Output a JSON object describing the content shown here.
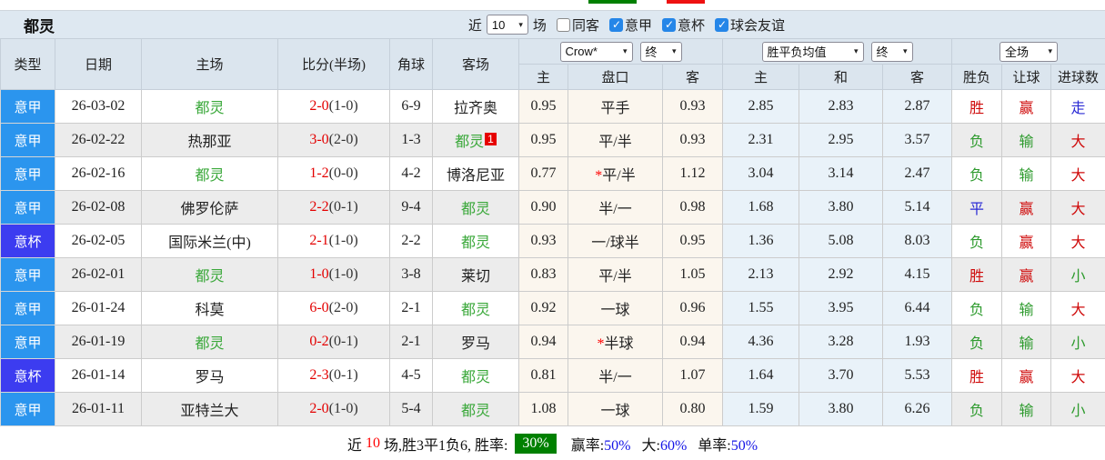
{
  "title": "都灵",
  "filters": {
    "near_label": "近",
    "recent_value": "10",
    "games_label": "场",
    "checkboxes": [
      {
        "label": "同客",
        "state": ""
      },
      {
        "label": "意甲",
        "state": "checked"
      },
      {
        "label": "意杯",
        "state": "checked"
      },
      {
        "label": "球会友谊",
        "state": "checked"
      }
    ]
  },
  "header": {
    "cols": [
      "类型",
      "日期",
      "主场",
      "比分(半场)",
      "角球",
      "客场"
    ],
    "odds_company_select": "Crow*",
    "odds_stage_select": "终",
    "odds_sub": [
      "主",
      "盘口",
      "客"
    ],
    "avg_select": "胜平负均值",
    "avg_stage_select": "终",
    "avg_sub": [
      "主",
      "和",
      "客"
    ],
    "scope_select": "全场",
    "result_sub": [
      "胜负",
      "让球",
      "进球数"
    ]
  },
  "rows": [
    {
      "league": "意甲",
      "lg": "serieA",
      "date": "26-03-02",
      "home": "都灵",
      "home_cls": "team",
      "score": "2-0",
      "half": "(1-0)",
      "corner": "6-9",
      "away": "拉齐奥",
      "away_cls": "",
      "away_sup": "",
      "crow_home": "0.95",
      "handicap_star": "",
      "handicap": "平手",
      "crow_away": "0.93",
      "avg_home": "2.85",
      "avg_draw": "2.83",
      "avg_away": "2.87",
      "result": "胜",
      "result_cls": "red",
      "let_result": "赢",
      "let_cls": "red",
      "goals": "走",
      "goals_cls": "blue"
    },
    {
      "league": "意甲",
      "lg": "serieA",
      "date": "26-02-22",
      "home": "热那亚",
      "home_cls": "",
      "score": "3-0",
      "half": "(2-0)",
      "corner": "1-3",
      "away": "都灵",
      "away_cls": "team",
      "away_sup": "1",
      "crow_home": "0.95",
      "handicap_star": "",
      "handicap": "平/半",
      "crow_away": "0.93",
      "avg_home": "2.31",
      "avg_draw": "2.95",
      "avg_away": "3.57",
      "result": "负",
      "result_cls": "green",
      "let_result": "输",
      "let_cls": "green",
      "goals": "大",
      "goals_cls": "red"
    },
    {
      "league": "意甲",
      "lg": "serieA",
      "date": "26-02-16",
      "home": "都灵",
      "home_cls": "team",
      "score": "1-2",
      "half": "(0-0)",
      "corner": "4-2",
      "away": "博洛尼亚",
      "away_cls": "",
      "away_sup": "",
      "crow_home": "0.77",
      "handicap_star": "*",
      "handicap": "平/半",
      "crow_away": "1.12",
      "avg_home": "3.04",
      "avg_draw": "3.14",
      "avg_away": "2.47",
      "result": "负",
      "result_cls": "green",
      "let_result": "输",
      "let_cls": "green",
      "goals": "大",
      "goals_cls": "red"
    },
    {
      "league": "意甲",
      "lg": "serieA",
      "date": "26-02-08",
      "home": "佛罗伦萨",
      "home_cls": "",
      "score": "2-2",
      "half": "(0-1)",
      "corner": "9-4",
      "away": "都灵",
      "away_cls": "team",
      "away_sup": "",
      "crow_home": "0.90",
      "handicap_star": "",
      "handicap": "半/一",
      "crow_away": "0.98",
      "avg_home": "1.68",
      "avg_draw": "3.80",
      "avg_away": "5.14",
      "result": "平",
      "result_cls": "blue",
      "let_result": "赢",
      "let_cls": "red",
      "goals": "大",
      "goals_cls": "red"
    },
    {
      "league": "意杯",
      "lg": "coppa",
      "date": "26-02-05",
      "home": "国际米兰(中)",
      "home_cls": "",
      "score": "2-1",
      "half": "(1-0)",
      "corner": "2-2",
      "away": "都灵",
      "away_cls": "team",
      "away_sup": "",
      "crow_home": "0.93",
      "handicap_star": "",
      "handicap": "一/球半",
      "crow_away": "0.95",
      "avg_home": "1.36",
      "avg_draw": "5.08",
      "avg_away": "8.03",
      "result": "负",
      "result_cls": "green",
      "let_result": "赢",
      "let_cls": "red",
      "goals": "大",
      "goals_cls": "red"
    },
    {
      "league": "意甲",
      "lg": "serieA",
      "date": "26-02-01",
      "home": "都灵",
      "home_cls": "team",
      "score": "1-0",
      "half": "(1-0)",
      "corner": "3-8",
      "away": "莱切",
      "away_cls": "",
      "away_sup": "",
      "crow_home": "0.83",
      "handicap_star": "",
      "handicap": "平/半",
      "crow_away": "1.05",
      "avg_home": "2.13",
      "avg_draw": "2.92",
      "avg_away": "4.15",
      "result": "胜",
      "result_cls": "red",
      "let_result": "赢",
      "let_cls": "red",
      "goals": "小",
      "goals_cls": "green"
    },
    {
      "league": "意甲",
      "lg": "serieA",
      "date": "26-01-24",
      "home": "科莫",
      "home_cls": "",
      "score": "6-0",
      "half": "(2-0)",
      "corner": "2-1",
      "away": "都灵",
      "away_cls": "team",
      "away_sup": "",
      "crow_home": "0.92",
      "handicap_star": "",
      "handicap": "一球",
      "crow_away": "0.96",
      "avg_home": "1.55",
      "avg_draw": "3.95",
      "avg_away": "6.44",
      "result": "负",
      "result_cls": "green",
      "let_result": "输",
      "let_cls": "green",
      "goals": "大",
      "goals_cls": "red"
    },
    {
      "league": "意甲",
      "lg": "serieA",
      "date": "26-01-19",
      "home": "都灵",
      "home_cls": "team",
      "score": "0-2",
      "half": "(0-1)",
      "corner": "2-1",
      "away": "罗马",
      "away_cls": "",
      "away_sup": "",
      "crow_home": "0.94",
      "handicap_star": "*",
      "handicap": "半球",
      "crow_away": "0.94",
      "avg_home": "4.36",
      "avg_draw": "3.28",
      "avg_away": "1.93",
      "result": "负",
      "result_cls": "green",
      "let_result": "输",
      "let_cls": "green",
      "goals": "小",
      "goals_cls": "green"
    },
    {
      "league": "意杯",
      "lg": "coppa",
      "date": "26-01-14",
      "home": "罗马",
      "home_cls": "",
      "score": "2-3",
      "half": "(0-1)",
      "corner": "4-5",
      "away": "都灵",
      "away_cls": "team",
      "away_sup": "",
      "crow_home": "0.81",
      "handicap_star": "",
      "handicap": "半/一",
      "crow_away": "1.07",
      "avg_home": "1.64",
      "avg_draw": "3.70",
      "avg_away": "5.53",
      "result": "胜",
      "result_cls": "red",
      "let_result": "赢",
      "let_cls": "red",
      "goals": "大",
      "goals_cls": "red"
    },
    {
      "league": "意甲",
      "lg": "serieA",
      "date": "26-01-11",
      "home": "亚特兰大",
      "home_cls": "",
      "score": "2-0",
      "half": "(1-0)",
      "corner": "5-4",
      "away": "都灵",
      "away_cls": "team",
      "away_sup": "",
      "crow_home": "1.08",
      "handicap_star": "",
      "handicap": "一球",
      "crow_away": "0.80",
      "avg_home": "1.59",
      "avg_draw": "3.80",
      "avg_away": "6.26",
      "result": "负",
      "result_cls": "green",
      "let_result": "输",
      "let_cls": "green",
      "goals": "小",
      "goals_cls": "green"
    }
  ],
  "footer": {
    "prefix": "近",
    "count": "10",
    "mid": "场,胜3平1负6, 胜率:",
    "win_rate": "30%",
    "stats": [
      {
        "label": "赢率:",
        "value": "50%"
      },
      {
        "label": "大:",
        "value": "60%"
      },
      {
        "label": "单率:",
        "value": "50%"
      }
    ]
  }
}
